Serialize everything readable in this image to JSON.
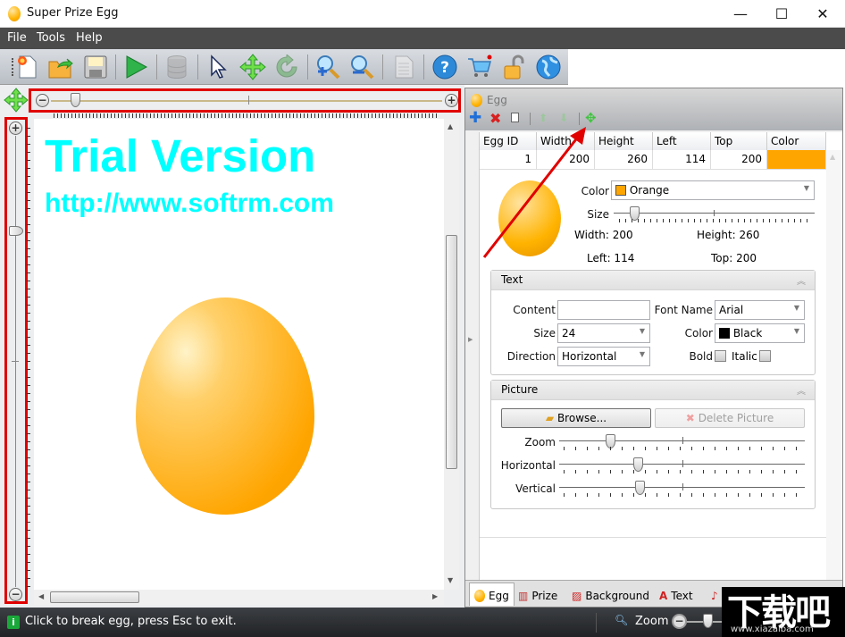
{
  "window": {
    "title": "Super Prize Egg",
    "controls": {
      "minimize": "—",
      "maximize": "☐",
      "close": "✕"
    }
  },
  "menu": [
    "File",
    "Tools",
    "Help"
  ],
  "toolbar": {
    "buttons": [
      {
        "name": "new-file-icon",
        "enabled": true
      },
      {
        "name": "open-folder-icon",
        "enabled": true
      },
      {
        "name": "save-icon",
        "enabled": true
      },
      {
        "name": "play-icon",
        "enabled": true
      },
      {
        "name": "database-icon",
        "enabled": false
      },
      {
        "name": "pointer-icon",
        "enabled": true
      },
      {
        "name": "move-icon",
        "enabled": true
      },
      {
        "name": "rotate-icon",
        "enabled": false
      },
      {
        "name": "zoom-in-icon",
        "enabled": true
      },
      {
        "name": "zoom-out-icon",
        "enabled": true
      },
      {
        "name": "document-icon",
        "enabled": false
      },
      {
        "name": "help-icon",
        "enabled": true
      },
      {
        "name": "shopping-cart-icon",
        "enabled": true
      },
      {
        "name": "unlock-icon",
        "enabled": true
      },
      {
        "name": "globe-icon",
        "enabled": true
      }
    ]
  },
  "canvas": {
    "trial_title": "Trial Version",
    "trial_url": "http://www.softrm.com",
    "trial_color": "#00ffff",
    "egg_color": "#ffa500",
    "horizontal_zoom_percent": 5,
    "vertical_zoom_percent": 20
  },
  "panel": {
    "title": "Egg",
    "toolbar": [
      "add-icon",
      "delete-icon",
      "copy-icon",
      "move-up-icon",
      "move-down-icon",
      "move-icon"
    ],
    "grid": {
      "columns": [
        "Egg ID",
        "Width",
        "Height",
        "Left",
        "Top",
        "Color"
      ],
      "rows": [
        {
          "id": "1",
          "width": "200",
          "height": "260",
          "left": "114",
          "top": "200",
          "color": "#ffa500"
        }
      ]
    },
    "detail": {
      "color_label": "Color",
      "color_value": "Orange",
      "color_swatch": "#ffa500",
      "size_label": "Size",
      "size_percent": 8,
      "width_text": "Width: 200",
      "height_text": "Height: 260",
      "left_text": "Left: 114",
      "top_text": "Top: 200"
    },
    "text_group": {
      "title": "Text",
      "content_label": "Content",
      "content_value": "",
      "font_name_label": "Font Name",
      "font_name_value": "Arial",
      "size_label": "Size",
      "size_value": "24",
      "color_label": "Color",
      "color_value": "Black",
      "color_swatch": "#000000",
      "direction_label": "Direction",
      "direction_value": "Horizontal",
      "bold_label": "Bold",
      "bold_checked": false,
      "italic_label": "Italic",
      "italic_checked": false
    },
    "picture_group": {
      "title": "Picture",
      "browse_label": "Browse...",
      "delete_label": "Delete Picture",
      "zoom_label": "Zoom",
      "zoom_percent": 19,
      "horizontal_label": "Horizontal",
      "horizontal_percent": 30,
      "vertical_label": "Vertical",
      "vertical_percent": 31
    },
    "tabs": [
      {
        "label": "Egg",
        "active": true
      },
      {
        "label": "Prize",
        "active": false
      },
      {
        "label": "Background",
        "active": false
      },
      {
        "label": "Text",
        "active": false
      }
    ]
  },
  "statusbar": {
    "message": "Click to break egg, press Esc to exit.",
    "zoom_label": "Zoom"
  },
  "watermark": {
    "title": "下载吧",
    "url": "www.xiazaiba.com"
  }
}
